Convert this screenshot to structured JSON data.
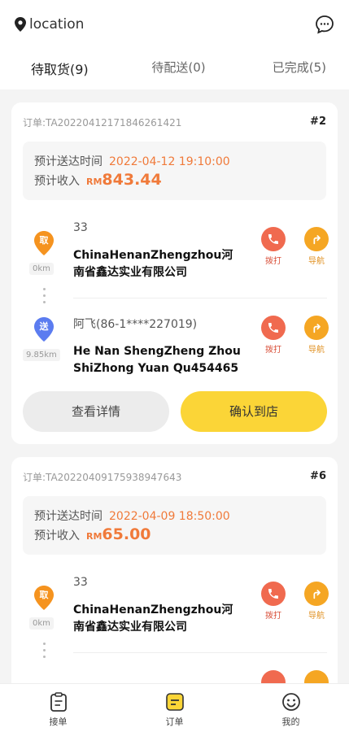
{
  "header": {
    "location_label": "location",
    "icons": {
      "location": "location-pin-icon",
      "chat": "chat-bubble-icon"
    }
  },
  "tabs": [
    {
      "label": "待取货(9)",
      "active": true
    },
    {
      "label": "待配送(0)",
      "active": false
    },
    {
      "label": "已完成(5)",
      "active": false
    }
  ],
  "orders": [
    {
      "order_no": "订单:TA20220412171846261421",
      "index": "#2",
      "eta_label": "预计送达时间",
      "eta_value": "2022-04-12 19:10:00",
      "income_label": "预计收入",
      "currency": "RM",
      "amount": "843.44",
      "pickup": {
        "pin": "取",
        "distance": "0km",
        "name": "33",
        "address": "ChinaHenanZhengzhou河南省鑫达实业有限公司"
      },
      "dropoff": {
        "pin": "送",
        "distance": "9.85km",
        "name": "阿飞(86-1****227019)",
        "address": "He Nan ShengZheng Zhou ShiZhong Yuan Qu454465"
      },
      "call_label": "拨打",
      "nav_label": "导航",
      "detail_btn": "查看详情",
      "confirm_btn": "确认到店"
    },
    {
      "order_no": "订单:TA20220409175938947643",
      "index": "#6",
      "eta_label": "预计送达时间",
      "eta_value": "2022-04-09 18:50:00",
      "income_label": "预计收入",
      "currency": "RM",
      "amount": "65.00",
      "pickup": {
        "pin": "取",
        "distance": "0km",
        "name": "33",
        "address": "ChinaHenanZhengzhou河南省鑫达实业有限公司"
      },
      "call_label": "拨打",
      "nav_label": "导航"
    }
  ],
  "bottom_nav": [
    {
      "label": "接单",
      "icon": "clipboard-icon",
      "active": false
    },
    {
      "label": "订单",
      "icon": "order-list-icon",
      "active": true
    },
    {
      "label": "我的",
      "icon": "smiley-face-icon",
      "active": false
    }
  ],
  "colors": {
    "accent": "#fbd537",
    "price": "#f07a3a",
    "pickup_pin": "#f5931f",
    "dropoff_pin": "#5b7cf0",
    "call": "#f06a4f",
    "nav": "#f5a623"
  }
}
